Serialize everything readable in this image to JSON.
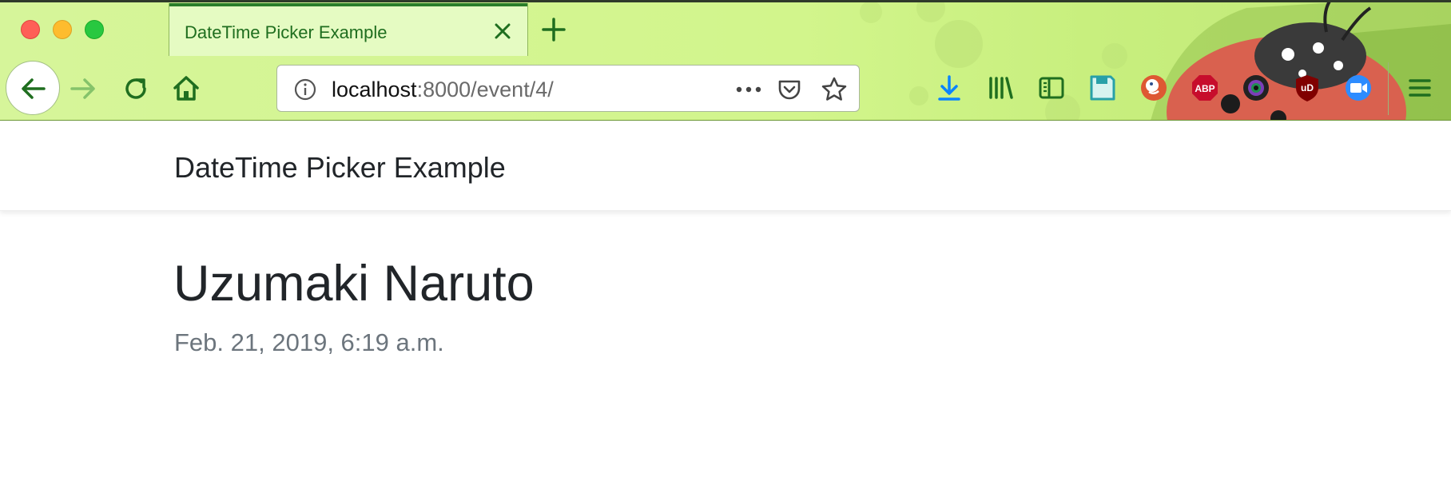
{
  "browser": {
    "tab": {
      "title": "DateTime Picker Example"
    },
    "url": {
      "host": "localhost",
      "path": ":8000/event/4/"
    },
    "toolbar_icons": [
      "back-arrow-icon",
      "forward-arrow-icon",
      "reload-icon",
      "home-icon",
      "info-icon",
      "more-icon",
      "pocket-icon",
      "star-icon",
      "download-icon",
      "library-icon",
      "sidebar-icon",
      "save-icon",
      "duckduckgo-icon",
      "adblock-plus-icon",
      "lens-icon",
      "ublock-icon",
      "zoom-icon",
      "hamburger-menu-icon"
    ],
    "abp_label": "ABP",
    "ublock_label": "uD"
  },
  "colors": {
    "chrome_green": "#d2f58c",
    "accent_green": "#1f6e1f",
    "text_dark": "#212529",
    "text_muted": "#6c757d"
  },
  "site": {
    "brand": "DateTime Picker Example"
  },
  "event": {
    "title": "Uzumaki Naruto",
    "datetime": "Feb. 21, 2019, 6:19 a.m."
  }
}
